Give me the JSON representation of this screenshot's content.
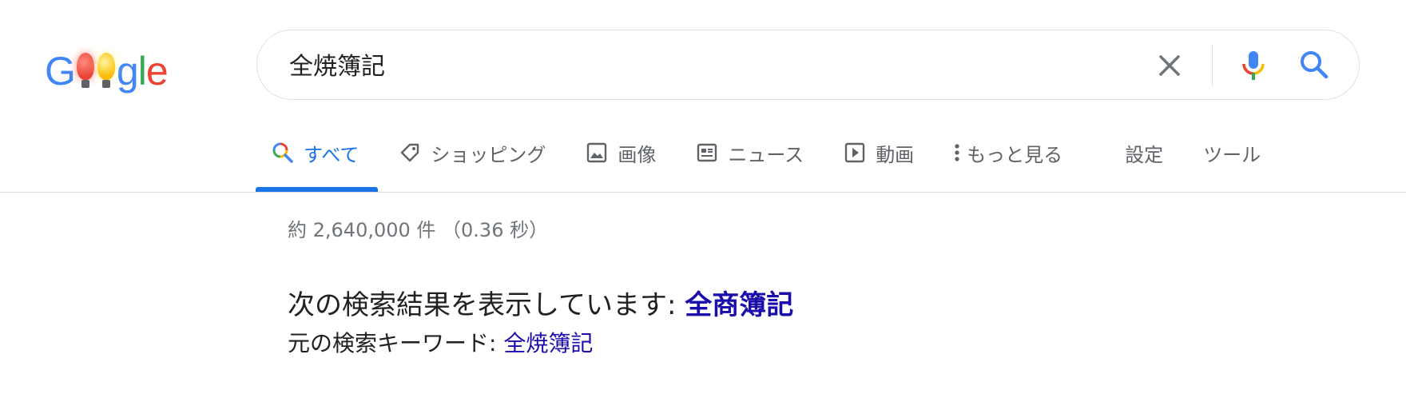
{
  "logo": {
    "letters": [
      "G",
      "o",
      "o",
      "g",
      "l",
      "e"
    ],
    "text": "Google"
  },
  "search": {
    "value": "全焼簿記",
    "clear_icon": "close-icon",
    "mic_icon": "microphone-icon",
    "search_icon": "search-icon"
  },
  "tabs": [
    {
      "label": "すべて",
      "icon": "search-icon",
      "active": true
    },
    {
      "label": "ショッピング",
      "icon": "tag-icon"
    },
    {
      "label": "画像",
      "icon": "image-icon"
    },
    {
      "label": "ニュース",
      "icon": "news-icon"
    },
    {
      "label": "動画",
      "icon": "play-icon"
    },
    {
      "label": "もっと見る",
      "icon": "more-vert-icon"
    }
  ],
  "tools": {
    "settings": "設定",
    "tools": "ツール"
  },
  "results": {
    "stats": "約 2,640,000 件 （0.36 秒）",
    "showing_prefix": "次の検索結果を表示しています: ",
    "showing_link": "全商簿記",
    "original_prefix": "元の検索キーワード: ",
    "original_link": "全焼簿記"
  },
  "colors": {
    "blue": "#4285f4",
    "red": "#ea4335",
    "yellow": "#fbbc05",
    "green": "#34a853",
    "link": "#1a0dab",
    "active_tab": "#1a73e8"
  }
}
